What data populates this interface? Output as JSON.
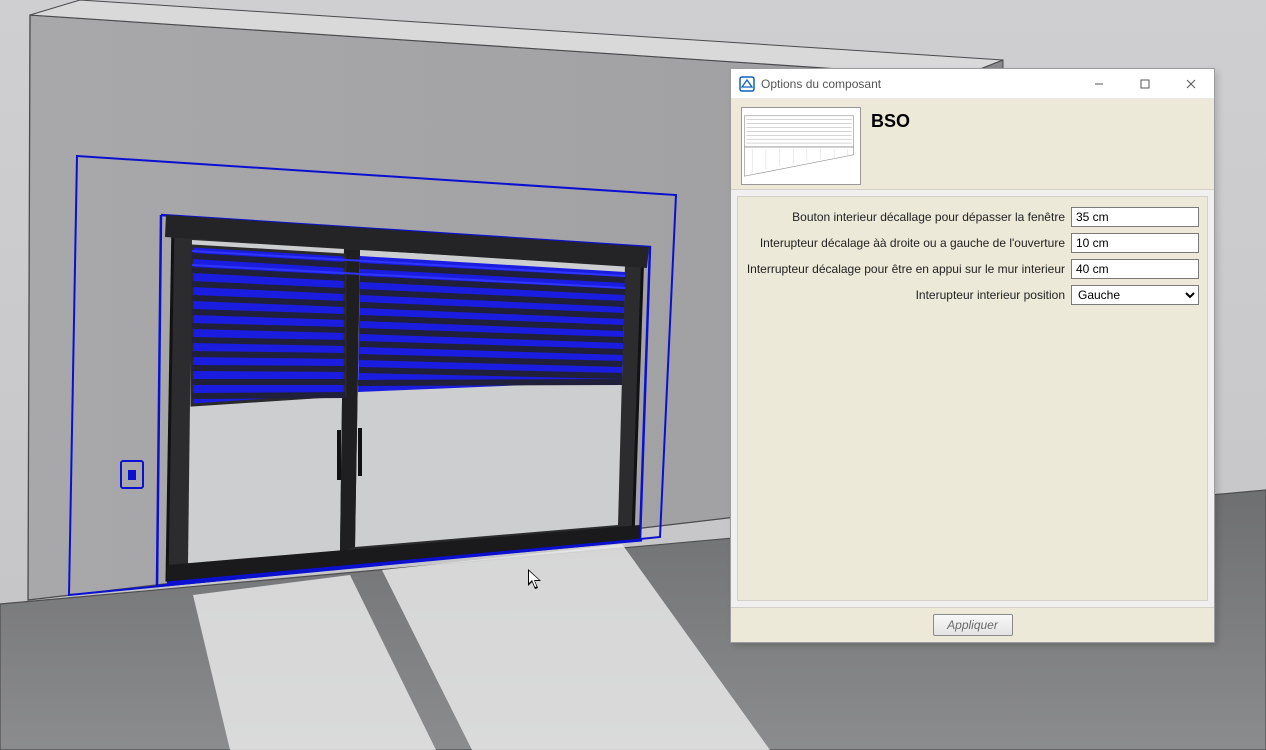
{
  "dialog": {
    "window_title": "Options du composant",
    "component_title": "BSO",
    "fields": [
      {
        "label": "Bouton interieur décallage pour dépasser la fenêtre",
        "value": "35 cm"
      },
      {
        "label": "Interupteur décalage àà droite ou a gauche de l'ouverture",
        "value": "10 cm"
      },
      {
        "label": "Interrupteur décalage pour être en appui sur le mur interieur",
        "value": "40 cm"
      },
      {
        "label": "Interupteur interieur position",
        "value": "Gauche",
        "select": true
      }
    ],
    "apply_label": "Appliquer"
  }
}
